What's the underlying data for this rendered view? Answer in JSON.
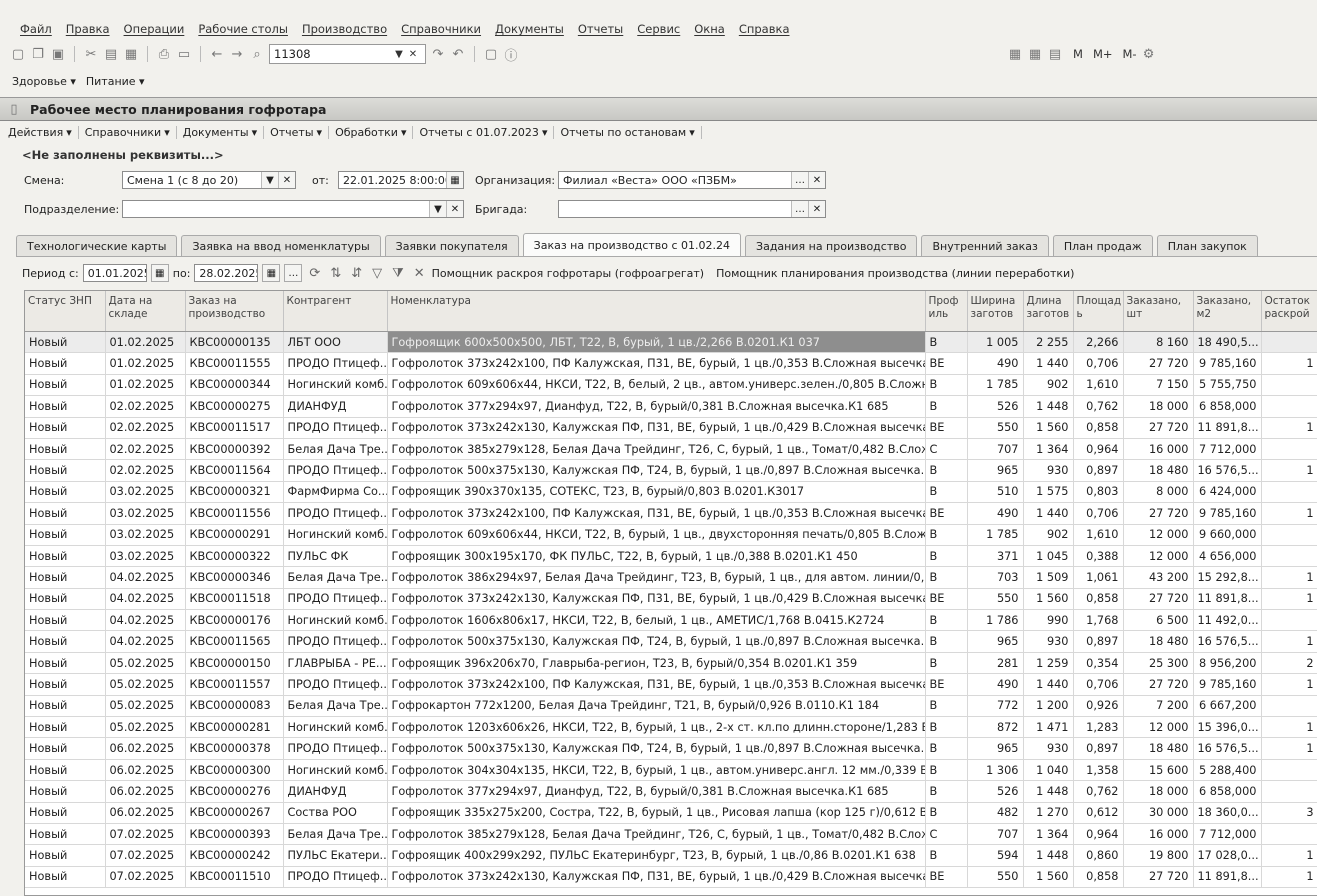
{
  "menu": [
    "Файл",
    "Правка",
    "Операции",
    "Рабочие столы",
    "Производство",
    "Справочники",
    "Документы",
    "Отчеты",
    "Сервис",
    "Окна",
    "Справка"
  ],
  "toolbar": {
    "search_value": "11308",
    "m_labels": [
      "M",
      "M+",
      "M-"
    ]
  },
  "subbar": [
    "Здоровье",
    "Питание"
  ],
  "window_title": "Рабочее место планирования гофротара",
  "actions": [
    "Действия",
    "Справочники",
    "Документы",
    "Отчеты",
    "Обработки",
    "Отчеты с 01.07.2023",
    "Отчеты по остановам"
  ],
  "requisites_note": "<Не заполнены реквизиты...>",
  "form": {
    "shift_label": "Смена:",
    "shift_value": "Смена 1 (с 8 до 20)",
    "from_label": "от:",
    "from_value": "22.01.2025  8:00:00",
    "org_label": "Организация:",
    "org_value": "Филиал «Веста» ООО «ПЗБМ»",
    "division_label": "Подразделение:",
    "division_value": "",
    "brigade_label": "Бригада:",
    "brigade_value": ""
  },
  "tabs": [
    "Технологические карты",
    "Заявка на ввод номенклатуры",
    "Заявки покупателя",
    "Заказ на производство с 01.02.24",
    "Задания на производство",
    "Внутренний заказ",
    "План продаж",
    "План закупок"
  ],
  "active_tab": 3,
  "period": {
    "label": "Период с:",
    "from": "01.01.2025",
    "to_label": "по:",
    "to": "28.02.2025",
    "helper1": "Помощник раскроя гофротары (гофроагрегат)",
    "helper2": "Помощник планирования производства (линии переработки)"
  },
  "columns": [
    "Статус ЗНП",
    "Дата на складе",
    "Заказ на производство",
    "Контрагент",
    "Номенклатура",
    "Проф иль",
    "Ширина заготов",
    "Длина заготов",
    "Площад ь",
    "Заказано, шт",
    "Заказано, м2",
    "Остаток раскрой"
  ],
  "rows": [
    [
      "Новый",
      "01.02.2025",
      "КВС00000135",
      "ЛБТ ООО",
      "Гофроящик 600х500х500, ЛБТ, Т22, В, бурый, 1 цв./2,266 В.0201.К1 037",
      "В",
      "1 005",
      "2 255",
      "2,266",
      "8 160",
      "18 490,5...",
      ""
    ],
    [
      "Новый",
      "01.02.2025",
      "КВС00011555",
      "ПРОДО Птицеф...",
      "Гофролоток 373х242х100, ПФ Калужская, П31, ВЕ, бурый, 1 цв./0,353 В.Сложная высечка.К1 ...",
      "ВЕ",
      "490",
      "1 440",
      "0,706",
      "27 720",
      "9 785,160",
      "1"
    ],
    [
      "Новый",
      "01.02.2025",
      "КВС00000344",
      "Ногинский комб...",
      "Гофролоток 609х606х44, НКСИ, Т22, В, белый, 2 цв., автом.универс.зелен./0,805 В.Сложная в...",
      "В",
      "1 785",
      "902",
      "1,610",
      "7 150",
      "5 755,750",
      ""
    ],
    [
      "Новый",
      "02.02.2025",
      "КВС00000275",
      "ДИАНФУД",
      "Гофролоток 377х294х97, Дианфуд, Т22, В, бурый/0,381 В.Сложная высечка.К1 685",
      "В",
      "526",
      "1 448",
      "0,762",
      "18 000",
      "6 858,000",
      ""
    ],
    [
      "Новый",
      "02.02.2025",
      "КВС00011517",
      "ПРОДО Птицеф...",
      "Гофролоток 373х242х130, Калужская ПФ, П31, ВЕ, бурый, 1 цв./0,429 В.Сложная высечка.К981",
      "ВЕ",
      "550",
      "1 560",
      "0,858",
      "27 720",
      "11 891,8...",
      "1"
    ],
    [
      "Новый",
      "02.02.2025",
      "КВС00000392",
      "Белая Дача Тре...",
      "Гофролоток 385х279х128, Белая Дача Трейдинг, Т26, С, бурый, 1 цв., Томат/0,482 В.Сложная ...",
      "С",
      "707",
      "1 364",
      "0,964",
      "16 000",
      "7 712,000",
      ""
    ],
    [
      "Новый",
      "02.02.2025",
      "КВС00011564",
      "ПРОДО Птицеф...",
      "Гофролоток 500х375х130, Калужская ПФ, Т24, В, бурый, 1 цв./0,897 В.Сложная высечка.К983",
      "В",
      "965",
      "930",
      "0,897",
      "18 480",
      "16 576,5...",
      "1"
    ],
    [
      "Новый",
      "03.02.2025",
      "КВС00000321",
      "ФармФирма Со...",
      "Гофроящик 390х370х135, СОТЕКС, Т23, В, бурый/0,803 В.0201.К3017",
      "В",
      "510",
      "1 575",
      "0,803",
      "8 000",
      "6 424,000",
      ""
    ],
    [
      "Новый",
      "03.02.2025",
      "КВС00011556",
      "ПРОДО Птицеф...",
      "Гофролоток 373х242х100, ПФ Калужская, П31, ВЕ, бурый, 1 цв./0,353 В.Сложная высечка.К1 ...",
      "ВЕ",
      "490",
      "1 440",
      "0,706",
      "27 720",
      "9 785,160",
      "1"
    ],
    [
      "Новый",
      "03.02.2025",
      "КВС00000291",
      "Ногинский комб...",
      "Гофролоток 609х606х44, НКСИ, Т22, В, бурый, 1 цв., двухсторонняя печать/0,805 В.Сложная в...",
      "В",
      "1 785",
      "902",
      "1,610",
      "12 000",
      "9 660,000",
      ""
    ],
    [
      "Новый",
      "03.02.2025",
      "КВС00000322",
      "ПУЛЬС ФК",
      "Гофроящик 300х195х170, ФК ПУЛЬС, Т22, В, бурый, 1 цв./0,388 В.0201.К1 450",
      "В",
      "371",
      "1 045",
      "0,388",
      "12 000",
      "4 656,000",
      ""
    ],
    [
      "Новый",
      "04.02.2025",
      "КВС00000346",
      "Белая Дача Тре...",
      "Гофролоток 386х294х97, Белая Дача Трейдинг, Т23, В, бурый, 1 цв., для автом. линии/0,354 В...",
      "В",
      "703",
      "1 509",
      "1,061",
      "43 200",
      "15 292,8...",
      "1"
    ],
    [
      "Новый",
      "04.02.2025",
      "КВС00011518",
      "ПРОДО Птицеф...",
      "Гофролоток 373х242х130, Калужская ПФ, П31, ВЕ, бурый, 1 цв./0,429 В.Сложная высечка.К981",
      "ВЕ",
      "550",
      "1 560",
      "0,858",
      "27 720",
      "11 891,8...",
      "1"
    ],
    [
      "Новый",
      "04.02.2025",
      "КВС00000176",
      "Ногинский комб...",
      "Гофролоток 1606х806х17, НКСИ, Т22, В, белый, 1 цв., АМЕТИС/1,768 В.0415.К2724",
      "В",
      "1 786",
      "990",
      "1,768",
      "6 500",
      "11 492,0...",
      ""
    ],
    [
      "Новый",
      "04.02.2025",
      "КВС00011565",
      "ПРОДО Птицеф...",
      "Гофролоток 500х375х130, Калужская ПФ, Т24, В, бурый, 1 цв./0,897 В.Сложная высечка.К983",
      "В",
      "965",
      "930",
      "0,897",
      "18 480",
      "16 576,5...",
      "1"
    ],
    [
      "Новый",
      "05.02.2025",
      "КВС00000150",
      "ГЛАВРЫБА - РЕ...",
      "Гофроящик 396х206х70, Главрыба-регион, Т23, В, бурый/0,354 В.0201.К1 359",
      "В",
      "281",
      "1 259",
      "0,354",
      "25 300",
      "8 956,200",
      "2"
    ],
    [
      "Новый",
      "05.02.2025",
      "КВС00011557",
      "ПРОДО Птицеф...",
      "Гофролоток 373х242х100, ПФ Калужская, П31, ВЕ, бурый, 1 цв./0,353 В.Сложная высечка.К1 ...",
      "ВЕ",
      "490",
      "1 440",
      "0,706",
      "27 720",
      "9 785,160",
      "1"
    ],
    [
      "Новый",
      "05.02.2025",
      "КВС00000083",
      "Белая Дача Тре...",
      "Гофрокартон 772х1200, Белая Дача Трейдинг, Т21, В, бурый/0,926 В.0110.К1 184",
      "В",
      "772",
      "1 200",
      "0,926",
      "7 200",
      "6 667,200",
      ""
    ],
    [
      "Новый",
      "05.02.2025",
      "КВС00000281",
      "Ногинский комб...",
      "Гофролоток 1203х606х26, НКСИ, Т22, В, бурый, 1 цв., 2-х ст. кл.по длинн.стороне/1,283 В.Сло...",
      "В",
      "872",
      "1 471",
      "1,283",
      "12 000",
      "15 396,0...",
      "1"
    ],
    [
      "Новый",
      "06.02.2025",
      "КВС00000378",
      "ПРОДО Птицеф...",
      "Гофролоток 500х375х130, Калужская ПФ, Т24, В, бурый, 1 цв./0,897 В.Сложная высечка.К983",
      "В",
      "965",
      "930",
      "0,897",
      "18 480",
      "16 576,5...",
      "1"
    ],
    [
      "Новый",
      "06.02.2025",
      "КВС00000300",
      "Ногинский комб...",
      "Гофролоток 304х304х135, НКСИ, Т22, В, бурый, 1 цв., автом.универс.англ. 12 мм./0,339 В.Сло...",
      "В",
      "1 306",
      "1 040",
      "1,358",
      "15 600",
      "5 288,400",
      ""
    ],
    [
      "Новый",
      "06.02.2025",
      "КВС00000276",
      "ДИАНФУД",
      "Гофролоток 377х294х97, Дианфуд, Т22, В, бурый/0,381 В.Сложная высечка.К1 685",
      "В",
      "526",
      "1 448",
      "0,762",
      "18 000",
      "6 858,000",
      ""
    ],
    [
      "Новый",
      "06.02.2025",
      "КВС00000267",
      "Соствa РОО",
      "Гофроящик 335х275х200, Состра, Т22, В, бурый, 1 цв., Рисовая лапша (кор 125 г)/0,612 В.0201...",
      "В",
      "482",
      "1 270",
      "0,612",
      "30 000",
      "18 360,0...",
      "3"
    ],
    [
      "Новый",
      "07.02.2025",
      "КВС00000393",
      "Белая Дача Тре...",
      "Гофролоток 385х279х128, Белая Дача Трейдинг, Т26, С, бурый, 1 цв., Томат/0,482 В.Сложная ...",
      "С",
      "707",
      "1 364",
      "0,964",
      "16 000",
      "7 712,000",
      ""
    ],
    [
      "Новый",
      "07.02.2025",
      "КВС00000242",
      "ПУЛЬС Екатери...",
      "Гофроящик 400х299х292, ПУЛЬС Екатеринбург, Т23, В, бурый, 1 цв./0,86 В.0201.К1 638",
      "В",
      "594",
      "1 448",
      "0,860",
      "19 800",
      "17 028,0...",
      "1"
    ],
    [
      "Новый",
      "07.02.2025",
      "КВС00011510",
      "ПРОДО Птицеф...",
      "Гофролоток 373х242х130, Калужская ПФ, П31, ВЕ, бурый, 1 цв./0,429 В.Сложная высечка.К981",
      "ВЕ",
      "550",
      "1 560",
      "0,858",
      "27 720",
      "11 891,8...",
      "1"
    ]
  ]
}
